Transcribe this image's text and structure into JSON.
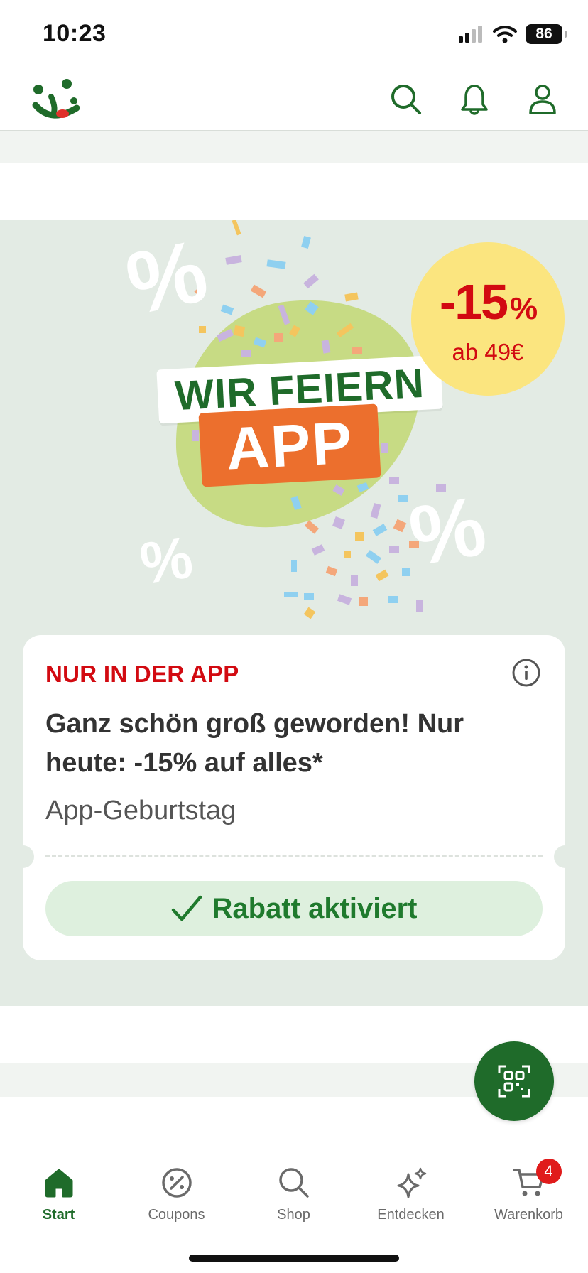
{
  "status_bar": {
    "time": "10:23",
    "battery": "86",
    "icons": [
      "signal-icon",
      "wifi-icon",
      "battery-icon"
    ]
  },
  "header": {
    "logo": "brand-logo",
    "icons": [
      "search-icon",
      "bell-icon",
      "user-icon"
    ]
  },
  "promo": {
    "banner": {
      "headline_top": "WIR FEIERN",
      "headline_bottom": "APP",
      "percent_symbol": "%",
      "badge_discount": "-15",
      "badge_percent": "%",
      "badge_minimum": "ab 49€"
    },
    "card": {
      "tag": "NUR IN DER APP",
      "title": "Ganz schön groß geworden! Nur heute: -15% auf alles*",
      "subtitle": "App-Geburtstag",
      "button_label": "Rabatt aktiviert",
      "info_icon": "info-icon"
    }
  },
  "fab": {
    "icon": "qr-scan-icon"
  },
  "bottom_nav": {
    "items": [
      {
        "label": "Start",
        "icon": "home-icon",
        "active": true
      },
      {
        "label": "Coupons",
        "icon": "percent-badge-icon"
      },
      {
        "label": "Shop",
        "icon": "search-icon"
      },
      {
        "label": "Entdecken",
        "icon": "sparkle-icon"
      },
      {
        "label": "Warenkorb",
        "icon": "cart-icon",
        "badge": "4"
      }
    ]
  },
  "colors": {
    "brand_green": "#1f6b2a",
    "accent_red": "#d20a11",
    "promo_background": "#e3ebe4",
    "badge_yellow": "#fbe57f",
    "app_orange": "#ec6f2d",
    "active_button_bg": "#def0de"
  }
}
